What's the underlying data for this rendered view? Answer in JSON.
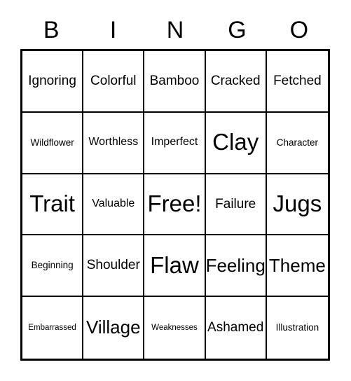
{
  "card": {
    "title": "BINGO",
    "header_letters": [
      "B",
      "I",
      "N",
      "G",
      "O"
    ],
    "free_space_label": "Free!",
    "colors": {
      "background": "#ffffff",
      "border": "#000000",
      "text": "#000000"
    },
    "rows": [
      [
        {
          "label": "Ignoring",
          "size": "sz-md"
        },
        {
          "label": "Colorful",
          "size": "sz-md"
        },
        {
          "label": "Bamboo",
          "size": "sz-md"
        },
        {
          "label": "Cracked",
          "size": "sz-md"
        },
        {
          "label": "Fetched",
          "size": "sz-md"
        }
      ],
      [
        {
          "label": "Wildflower",
          "size": "sz-xs"
        },
        {
          "label": "Worthless",
          "size": "sz-sm"
        },
        {
          "label": "Imperfect",
          "size": "sz-sm"
        },
        {
          "label": "Clay",
          "size": "sz-xl"
        },
        {
          "label": "Character",
          "size": "sz-xs"
        }
      ],
      [
        {
          "label": "Trait",
          "size": "sz-xl"
        },
        {
          "label": "Valuable",
          "size": "sz-sm"
        },
        {
          "label": "Free!",
          "size": "sz-xl"
        },
        {
          "label": "Failure",
          "size": "sz-md"
        },
        {
          "label": "Jugs",
          "size": "sz-xl"
        }
      ],
      [
        {
          "label": "Beginning",
          "size": "sz-xs"
        },
        {
          "label": "Shoulder",
          "size": "sz-md"
        },
        {
          "label": "Flaw",
          "size": "sz-xl"
        },
        {
          "label": "Feeling",
          "size": "sz-lg"
        },
        {
          "label": "Theme",
          "size": "sz-lg"
        }
      ],
      [
        {
          "label": "Embarrassed",
          "size": "sz-xxs"
        },
        {
          "label": "Village",
          "size": "sz-lg"
        },
        {
          "label": "Weaknesses",
          "size": "sz-xxs"
        },
        {
          "label": "Ashamed",
          "size": "sz-md"
        },
        {
          "label": "Illustration",
          "size": "sz-xs"
        }
      ]
    ]
  }
}
